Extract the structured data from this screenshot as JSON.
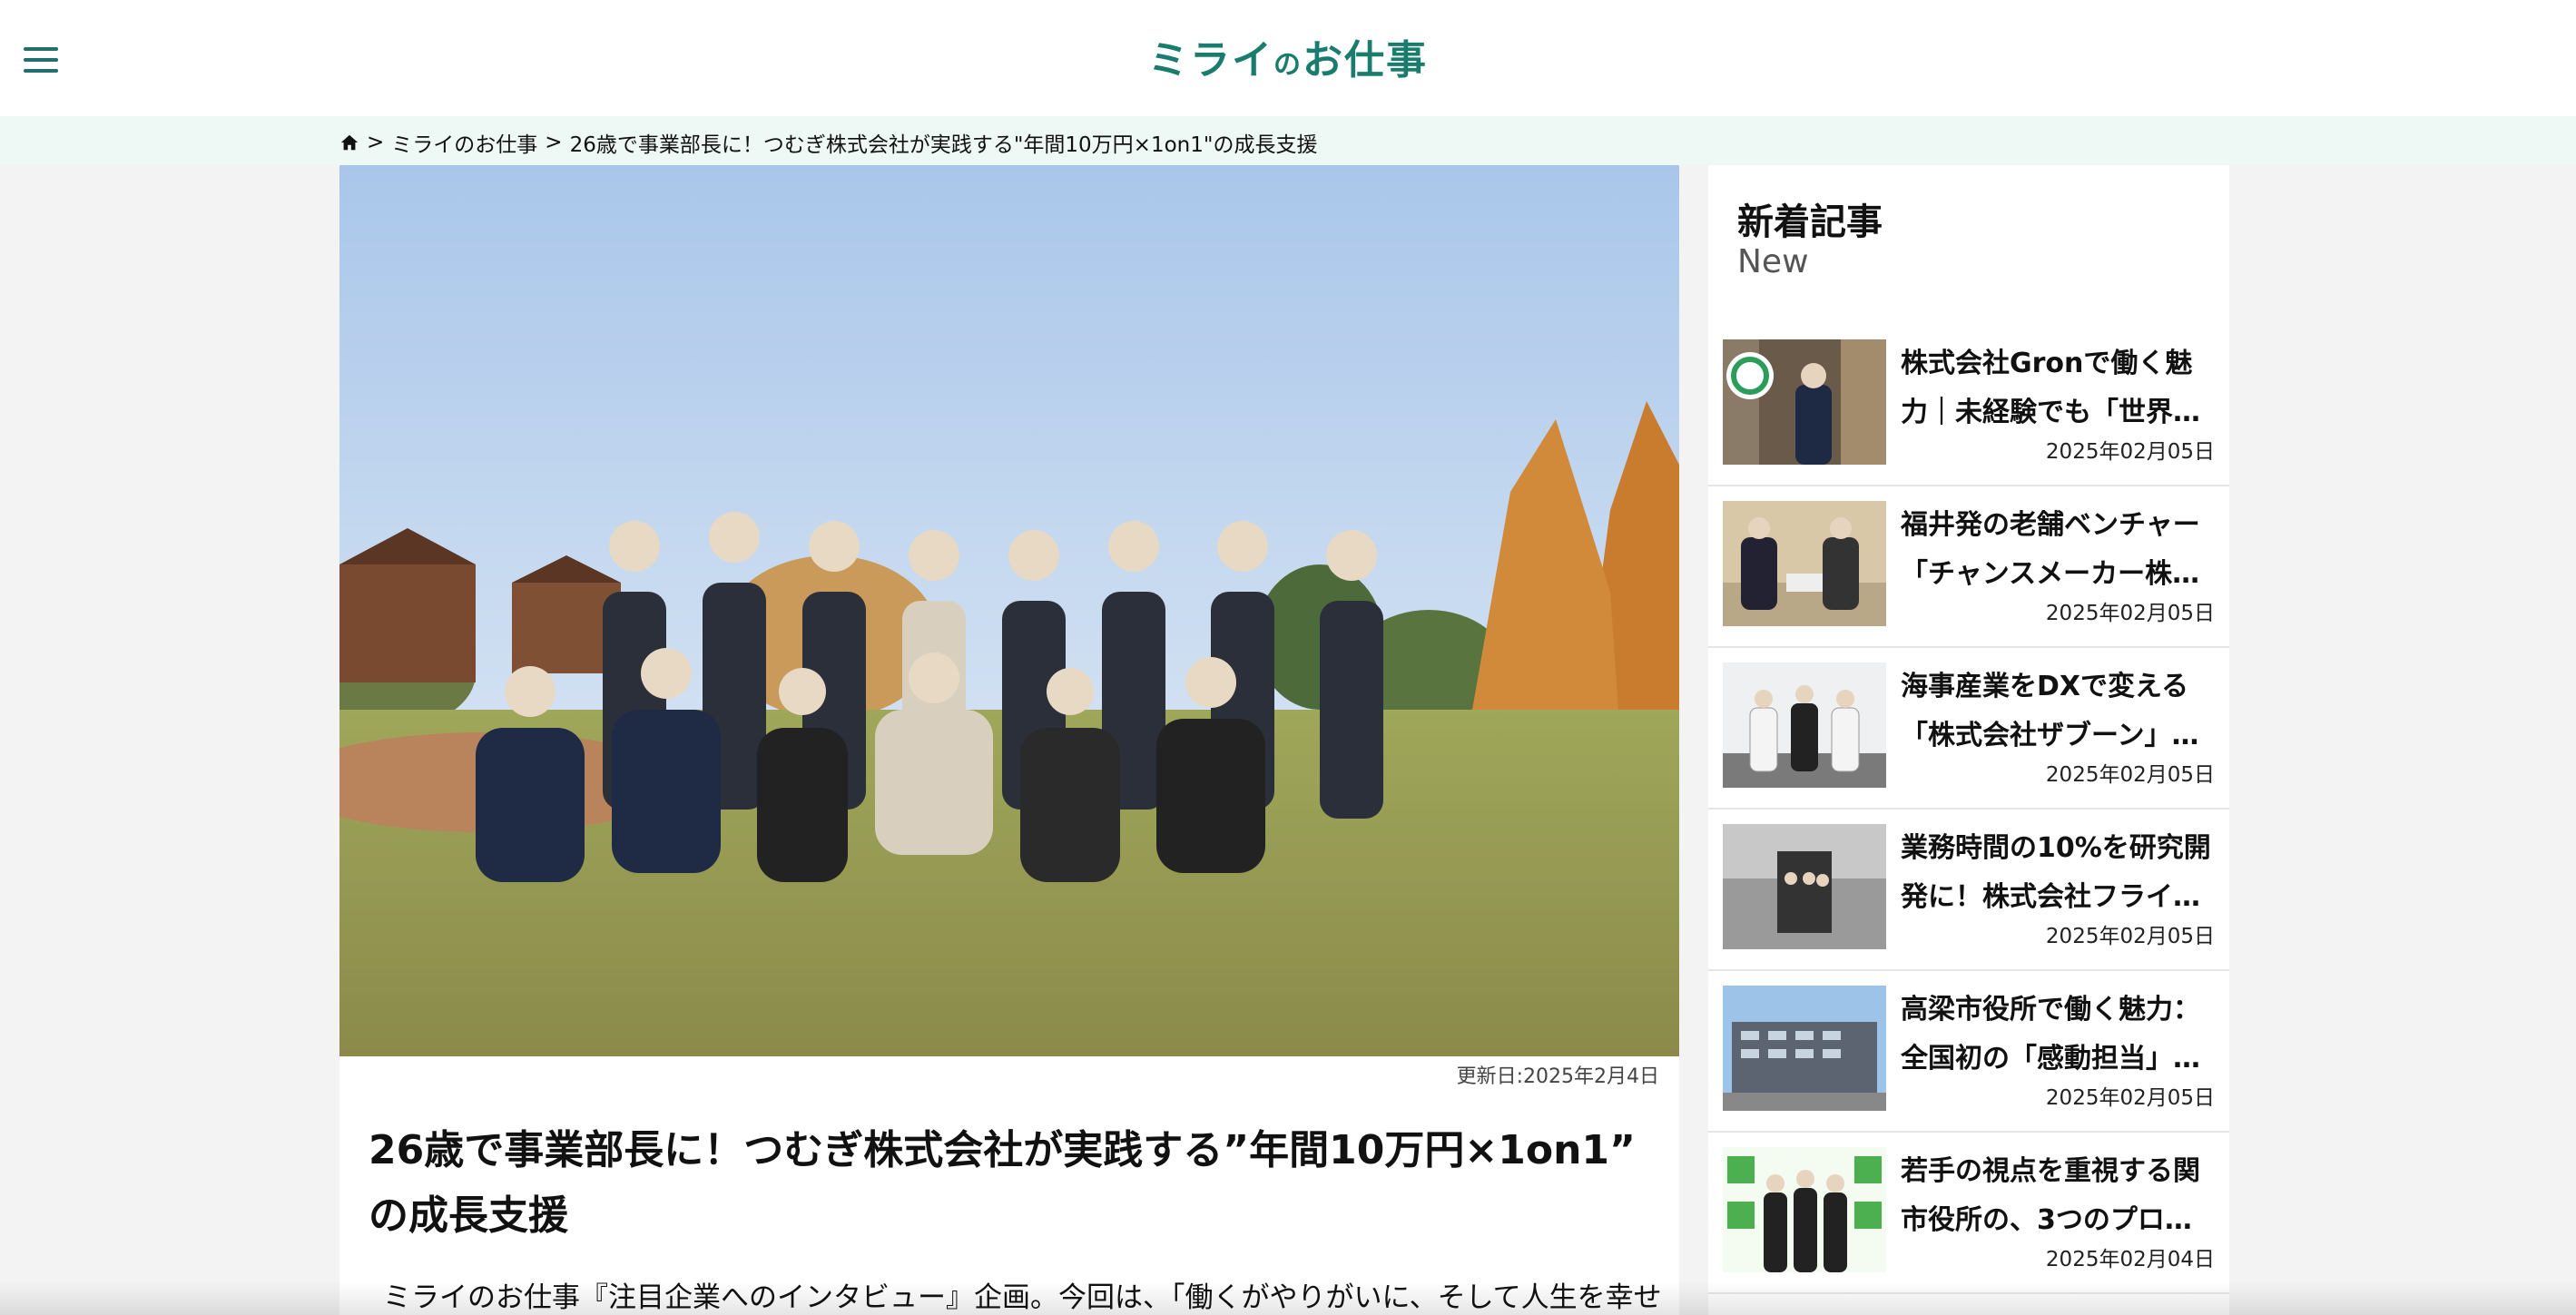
{
  "header": {
    "logo_part1": "ミライ",
    "logo_part2": "の",
    "logo_part3": "お仕事",
    "menu_icon": "hamburger-icon"
  },
  "breadcrumb": {
    "home_icon": "home-icon",
    "sep": ">",
    "level1": "ミライのお仕事",
    "current": "26歳で事業部長に！つむぎ株式会社が実践する\"年間10万円×1on1\"の成長支援"
  },
  "article": {
    "updated": "更新日:2025年2月4日",
    "title": "26歳で事業部長に！つむぎ株式会社が実践する”年間10万円×1on1” の成長支援",
    "lead": "ミライのお仕事『注目企業へのインタビュー』企画。今回は、「働くがやりがいに、そして人生を幸せ"
  },
  "sidebar": {
    "title": "新着記事",
    "subtitle": "New",
    "items": [
      {
        "text": "株式会社Gronで働く魅力｜未経験でも「世界…",
        "date": "2025年02月05日"
      },
      {
        "text": "福井発の老舗ベンチャー「チャンスメーカー株…",
        "date": "2025年02月05日"
      },
      {
        "text": "海事産業をDXで変える「株式会社ザブーン」…",
        "date": "2025年02月05日"
      },
      {
        "text": "業務時間の10%を研究開発に！株式会社フライ…",
        "date": "2025年02月05日"
      },
      {
        "text": "高梁市役所で働く魅力：全国初の「感動担当」…",
        "date": "2025年02月05日"
      },
      {
        "text": "若手の視点を重視する関市役所の、3つのプロ…",
        "date": "2025年02月04日"
      }
    ]
  },
  "colors": {
    "brand": "#1a7c6c",
    "crumb_bg": "#eef8f5",
    "page_bg": "#f3f3f3"
  }
}
